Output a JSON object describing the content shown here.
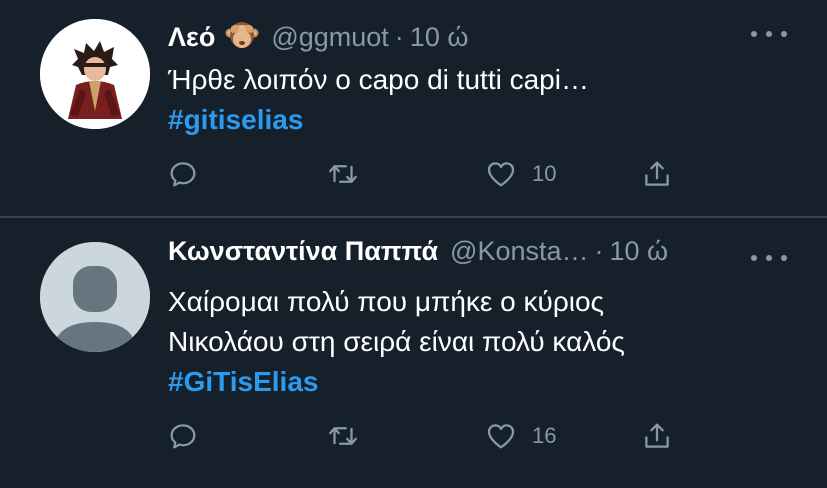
{
  "tweets": [
    {
      "name": "Λεό",
      "emoji_icon": "see-no-evil-monkey-icon",
      "handle": "@ggmuot",
      "separator": "·",
      "time": "10 ώ",
      "lines": [
        "Ήρθε λοιπόν ο capo di tutti capi…"
      ],
      "hashtag": "#gitiselias",
      "likes": "10"
    },
    {
      "name": "Κωνσταντίνα Παππά",
      "handle": "@Konsta…",
      "separator": "·",
      "time": "10 ώ",
      "lines": [
        "Χαίρομαι πολύ που μπήκε ο κύριος",
        "Νικολάου στη σειρά είναι πολύ καλός"
      ],
      "hashtag": "#GiTisElias",
      "likes": "16"
    }
  ],
  "colors": {
    "background": "#15202b",
    "divider": "#38444d",
    "secondary_text": "#8899a6",
    "hashtag": "#2b9bf0"
  }
}
